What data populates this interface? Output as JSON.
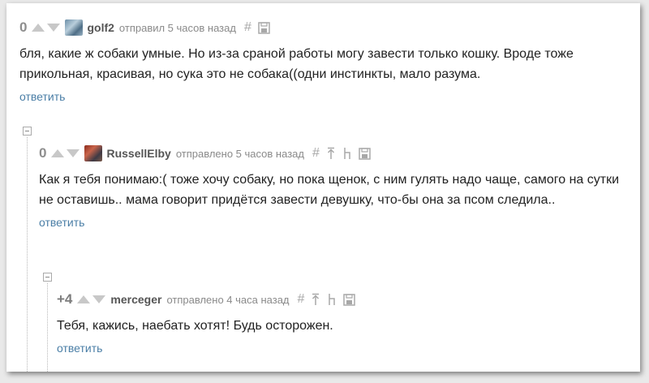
{
  "comments": [
    {
      "rating": "0",
      "user": "golf2",
      "meta": "отправил 5 часов назад",
      "text": "бля, какие ж собаки умные. Но из-за сраной работы могу завести только кошку. Вроде тоже прикольная, красивая, но сука это не собака((одни инстинкты, мало разума.",
      "reply": "ответить"
    },
    {
      "rating": "0",
      "user": "RussellElby",
      "meta": "отправлено 5 часов назад",
      "text": "Как я тебя понимаю:( тоже хочу собаку, но пока щенок, с ним гулять надо чаще, самого на сутки не оставишь.. мама говорит придётся завести девушку, что-бы она за псом следила..",
      "reply": "ответить"
    },
    {
      "rating": "+4",
      "user": "merceger",
      "meta": "отправлено 4 часа назад",
      "text": "Тебя, кажись, наебать хотят! Будь осторожен.",
      "reply": "ответить"
    }
  ],
  "icons": [
    "up-vote-icon",
    "down-vote-icon",
    "hash-icon",
    "save-icon",
    "parent-icon",
    "branch-icon"
  ]
}
